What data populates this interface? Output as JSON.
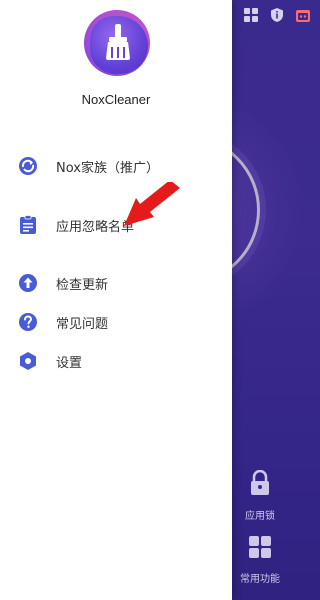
{
  "app": {
    "name": "NoxCleaner"
  },
  "menu": [
    {
      "label": "Nox家族（推广）",
      "icon": "sync-circle-icon"
    },
    {
      "label": "应用忽略名单",
      "icon": "clipboard-list-icon"
    },
    {
      "label": "检查更新",
      "icon": "upload-circle-icon"
    },
    {
      "label": "常见问题",
      "icon": "question-circle-icon"
    },
    {
      "label": "设置",
      "icon": "hexagon-settings-icon"
    }
  ],
  "background": {
    "bottom_items": [
      {
        "label": "应用锁",
        "icon": "lock-icon"
      },
      {
        "label": "常用功能",
        "icon": "grid-icon"
      }
    ],
    "top_icons": [
      "grid-icon",
      "info-icon",
      "gift-icon"
    ]
  },
  "colors": {
    "accent": "#4a5bd6",
    "drawer_bg": "#ffffff",
    "background_app": "#3b2a8e",
    "arrow": "#e51b1b"
  }
}
